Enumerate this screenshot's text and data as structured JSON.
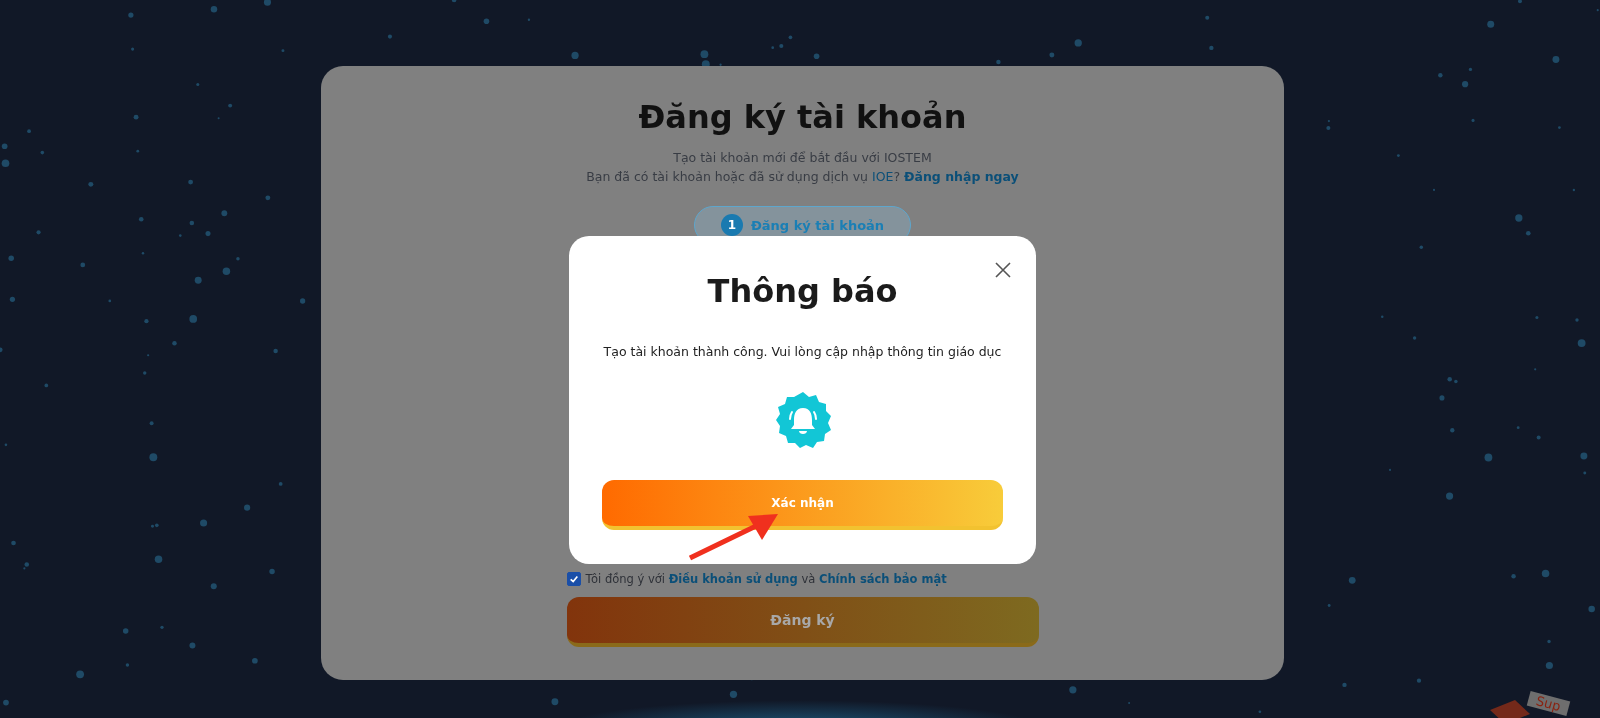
{
  "page": {
    "title": "Đăng ký tài khoản",
    "intro": "Tạo tài khoản mới để bắt đầu với IOSTEM",
    "login_prompt": {
      "text": "Bạn đã có tài khoản hoặc đã sử dụng dịch vụ",
      "service_link": "IOE",
      "mark": "?",
      "login_link": "Đăng nhập ngay"
    },
    "steps": [
      {
        "number": "1",
        "label": "Đăng ký tài khoản",
        "selected": true
      }
    ],
    "terms": {
      "checked": true,
      "text": "Tôi đồng ý với",
      "terms_link": "Điều khoản sử dụng",
      "joiner": "và",
      "privacy_link": "Chính sách bảo mật"
    },
    "submit": "Đăng ký"
  },
  "corner_logo": {
    "text": "Sup"
  },
  "dialog": {
    "title": "Thông báo",
    "message": "Tạo tài khoản thành công. Vui lòng cập nhập thông tin giáo dục",
    "confirm": "Xác nhận"
  }
}
